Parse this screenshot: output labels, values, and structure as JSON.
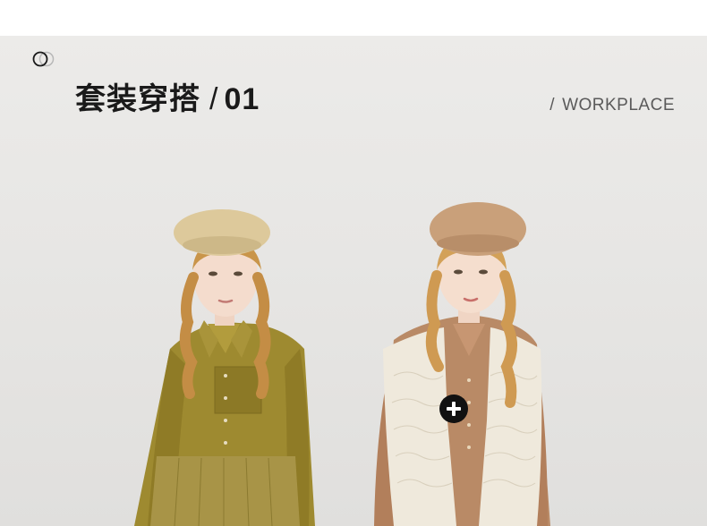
{
  "header": {
    "title": "套装穿搭",
    "separator": "/",
    "number": "01",
    "category_slash": "/",
    "category": "WORKPLACE"
  },
  "hotspot": {
    "icon": "plus-icon"
  },
  "colors": {
    "background": "#e8e7e5",
    "olive_dress": "#9e8a30",
    "camel_shirt": "#b98a66",
    "cream_vest": "#efe9dc",
    "beret_cream": "#ddc99b",
    "beret_camel": "#c9a07a",
    "hotspot": "#111111"
  }
}
